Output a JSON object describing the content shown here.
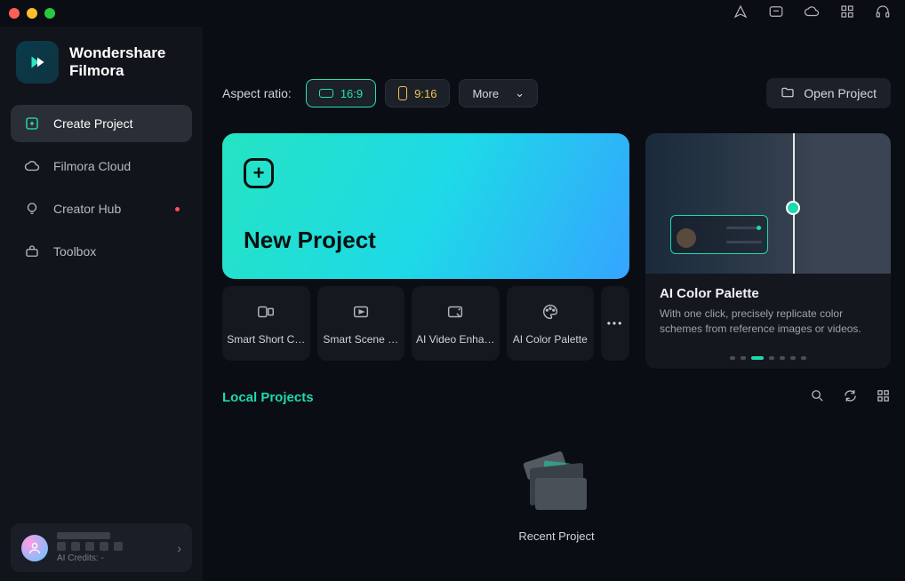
{
  "app": {
    "brand1": "Wondershare",
    "brand2": "Filmora"
  },
  "sidebar": {
    "items": [
      {
        "label": "Create Project"
      },
      {
        "label": "Filmora Cloud"
      },
      {
        "label": "Creator Hub"
      },
      {
        "label": "Toolbox"
      }
    ]
  },
  "user": {
    "credits_label": "AI Credits: -"
  },
  "topbar": {
    "aspect_label": "Aspect ratio:",
    "ratios": [
      {
        "label": "16:9"
      },
      {
        "label": "9:16"
      }
    ],
    "more": "More",
    "open_project": "Open Project"
  },
  "new_project": {
    "label": "New Project"
  },
  "tools": [
    {
      "label": "Smart Short C…"
    },
    {
      "label": "Smart Scene …"
    },
    {
      "label": "AI Video Enha…"
    },
    {
      "label": "AI Color Palette"
    }
  ],
  "feature": {
    "title": "AI Color Palette",
    "desc": "With one click, precisely replicate color schemes from reference images or videos.",
    "active_index": 2,
    "count": 7
  },
  "local": {
    "title": "Local Projects",
    "recent_label": "Recent Project"
  }
}
